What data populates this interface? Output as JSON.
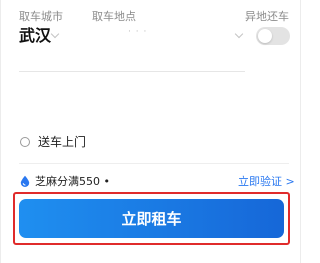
{
  "form": {
    "pickup_city_label": "取车城市",
    "pickup_city_value": "武汉",
    "pickup_location_label": "取车地点",
    "pickup_location_value": "· · ·",
    "diff_return_label": "异地还车",
    "diff_return_enabled": false,
    "delivery_label": "送车上门",
    "delivery_selected": false
  },
  "credit": {
    "text": "芝麻分满550 •",
    "verify_link": "立即验证 >"
  },
  "cta": {
    "label": "立即租车"
  },
  "colors": {
    "primary": "#1f7fea",
    "link": "#2a78f0",
    "highlight_border": "#e02b2b"
  },
  "icons": {
    "credit_icon": "drop-icon",
    "pickup_city_chevron": "chevron-down-icon",
    "pickup_location_chevron": "chevron-down-icon"
  }
}
